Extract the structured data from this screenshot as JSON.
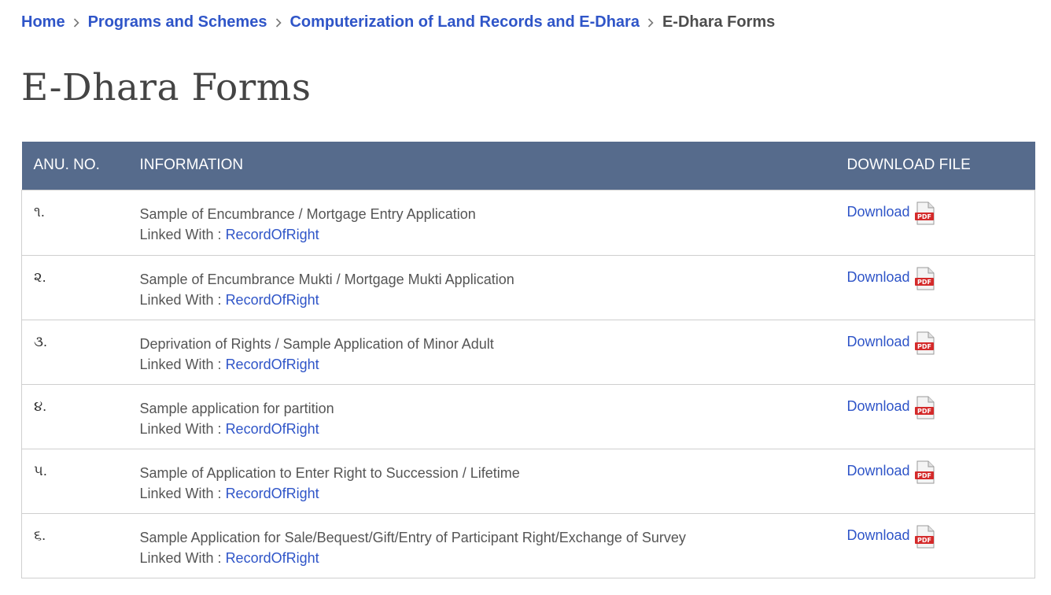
{
  "breadcrumb": {
    "items": [
      {
        "label": "Home"
      },
      {
        "label": "Programs and Schemes"
      },
      {
        "label": "Computerization of Land Records and E-Dhara"
      }
    ],
    "current": "E-Dhara Forms"
  },
  "page": {
    "title": "E-Dhara Forms"
  },
  "table": {
    "headers": {
      "no": "ANU. NO.",
      "info": "INFORMATION",
      "download": "DOWNLOAD FILE"
    },
    "linked_prefix": "Linked With :",
    "rows": [
      {
        "no": "૧.",
        "title": "Sample of Encumbrance / Mortgage Entry Application",
        "linked": "RecordOfRight",
        "download": "Download"
      },
      {
        "no": "૨.",
        "title": "Sample of Encumbrance Mukti / Mortgage Mukti Application",
        "linked": "RecordOfRight",
        "download": "Download"
      },
      {
        "no": "૩.",
        "title": "Deprivation of Rights / Sample Application of Minor Adult",
        "linked": "RecordOfRight",
        "download": "Download"
      },
      {
        "no": "૪.",
        "title": "Sample application for partition",
        "linked": "RecordOfRight",
        "download": "Download"
      },
      {
        "no": "૫.",
        "title": "Sample of Application to Enter Right to Succession / Lifetime",
        "linked": "RecordOfRight",
        "download": "Download"
      },
      {
        "no": "૬.",
        "title": "Sample Application for Sale/Bequest/Gift/Entry of Participant Right/Exchange of Survey",
        "linked": "RecordOfRight",
        "download": "Download"
      }
    ]
  },
  "icons": {
    "separator": "chevron-right-icon",
    "file": "pdf-file-icon"
  },
  "colors": {
    "link": "#2f55c8",
    "header_bg": "#566b8c",
    "pdf_red": "#d42a2a"
  }
}
